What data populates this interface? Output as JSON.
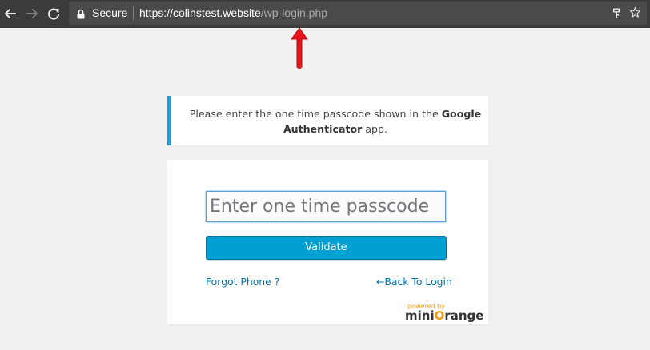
{
  "browser": {
    "security_label": "Secure",
    "url_host": "https://colinstest.website",
    "url_path": "/wp-login.php",
    "icons": [
      "back-arrow-icon",
      "forward-arrow-icon",
      "reload-icon",
      "lock-icon",
      "key-icon",
      "star-icon"
    ]
  },
  "message": {
    "text_before": "Please enter the one time passcode shown in the ",
    "bold_part_1": "Google",
    "bold_part_2": "Authenticator",
    "text_after": " app."
  },
  "form": {
    "otp_placeholder": "Enter one time passcode",
    "otp_value": "",
    "validate_label": "Validate",
    "forgot_phone_label": "Forgot Phone ?",
    "back_to_login_label": "←Back To Login"
  },
  "branding": {
    "powered_by": "powered by",
    "logo_part_1": "mini",
    "logo_o": "O",
    "logo_part_2": "range"
  },
  "colors": {
    "accent_blue": "#00a0d2",
    "message_border": "#1ba0d8",
    "link": "#0073aa",
    "annotation_arrow": "#e8141b",
    "brand_orange": "#f39c12"
  }
}
